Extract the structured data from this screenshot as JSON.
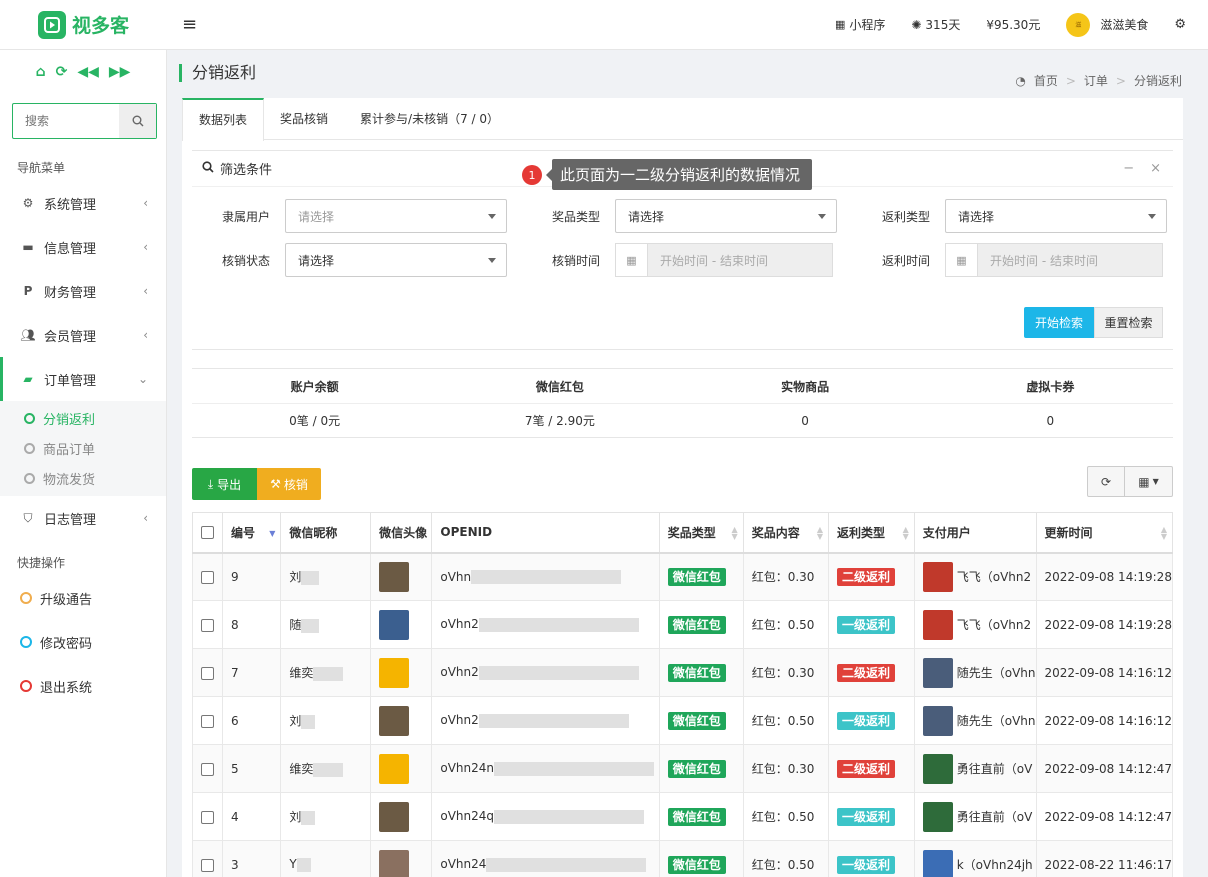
{
  "app": {
    "name": "视多客"
  },
  "top": {
    "miniprogram": "小程序",
    "days": "315天",
    "balance": "¥95.30元",
    "user": "滋滋美食",
    "avatar_text": "滋滋美食"
  },
  "sidebar": {
    "search_placeholder": "搜索",
    "nav_header": "导航菜单",
    "items": [
      {
        "label": "系统管理",
        "icon": "gear-icon"
      },
      {
        "label": "信息管理",
        "icon": "briefcase-icon"
      },
      {
        "label": "财务管理",
        "icon": "paypal-icon"
      },
      {
        "label": "会员管理",
        "icon": "users-icon"
      },
      {
        "label": "订单管理",
        "icon": "truck-icon"
      },
      {
        "label": "日志管理",
        "icon": "shield-icon"
      }
    ],
    "sub_items": [
      {
        "label": "分销返利"
      },
      {
        "label": "商品订单"
      },
      {
        "label": "物流发货"
      }
    ],
    "quick_header": "快捷操作",
    "quick": [
      {
        "label": "升级通告",
        "color": "#f0ad4e"
      },
      {
        "label": "修改密码",
        "color": "#1cb6e8"
      },
      {
        "label": "退出系统",
        "color": "#e53935"
      }
    ]
  },
  "page": {
    "title": "分销返利",
    "breadcrumb": [
      "首页",
      "订单",
      "分销返利"
    ],
    "tabs": [
      "数据列表",
      "奖品核销",
      "累计参与/未核销（7 / 0）"
    ]
  },
  "filter": {
    "title": "筛选条件",
    "tooltip": "此页面为一二级分销返利的数据情况",
    "tooltip_badge": "1",
    "fields": {
      "owner": {
        "label": "隶属用户",
        "value": "请选择"
      },
      "prize_type": {
        "label": "奖品类型",
        "value": "请选择"
      },
      "rebate_type": {
        "label": "返利类型",
        "value": "请选择"
      },
      "verify_status": {
        "label": "核销状态",
        "value": "请选择"
      },
      "verify_time": {
        "label": "核销时间",
        "placeholder": "开始时间 - 结束时间"
      },
      "rebate_time": {
        "label": "返利时间",
        "placeholder": "开始时间 - 结束时间"
      }
    },
    "search_btn": "开始检索",
    "reset_btn": "重置检索"
  },
  "stats": {
    "headers": [
      "账户余额",
      "微信红包",
      "实物商品",
      "虚拟卡券"
    ],
    "values": [
      "0笔 / 0元",
      "7笔 / 2.90元",
      "0",
      "0"
    ]
  },
  "toolbar": {
    "export": "导出",
    "verify": "核销"
  },
  "table": {
    "headers": [
      "编号",
      "微信昵称",
      "微信头像",
      "OPENID",
      "奖品类型",
      "奖品内容",
      "返利类型",
      "支付用户",
      "更新时间"
    ],
    "rows": [
      {
        "id": "9",
        "nick": "刘",
        "openid": "oVhn",
        "prize": "微信红包",
        "content": "红包：0.30",
        "rebate": "二级返利",
        "payer": "飞飞（oVhn2",
        "time": "2022-09-08 14:19:28"
      },
      {
        "id": "8",
        "nick": "随",
        "openid": "oVhn2",
        "prize": "微信红包",
        "content": "红包：0.50",
        "rebate": "一级返利",
        "payer": "飞飞（oVhn2",
        "time": "2022-09-08 14:19:28"
      },
      {
        "id": "7",
        "nick": "维奕",
        "openid": "oVhn2",
        "prize": "微信红包",
        "content": "红包：0.30",
        "rebate": "二级返利",
        "payer": "随先生（oVhn",
        "time": "2022-09-08 14:16:12"
      },
      {
        "id": "6",
        "nick": "刘",
        "openid": "oVhn2",
        "prize": "微信红包",
        "content": "红包：0.50",
        "rebate": "一级返利",
        "payer": "随先生（oVhn",
        "time": "2022-09-08 14:16:12"
      },
      {
        "id": "5",
        "nick": "维奕",
        "openid": "oVhn24n",
        "prize": "微信红包",
        "content": "红包：0.30",
        "rebate": "二级返利",
        "payer": "勇往直前（oV",
        "time": "2022-09-08 14:12:47"
      },
      {
        "id": "4",
        "nick": "刘",
        "openid": "oVhn24q",
        "prize": "微信红包",
        "content": "红包：0.50",
        "rebate": "一级返利",
        "payer": "勇往直前（oV",
        "time": "2022-09-08 14:12:47"
      },
      {
        "id": "3",
        "nick": "Y",
        "openid": "oVhn24",
        "prize": "微信红包",
        "content": "红包：0.50",
        "rebate": "一级返利",
        "payer": "k（oVhn24jh",
        "time": "2022-08-22 11:46:17"
      }
    ]
  },
  "colors": {
    "primary": "#28b463",
    "info": "#1cb6e8",
    "warning": "#f0ad1f",
    "danger": "#e53935",
    "teal": "#3cc4c8"
  }
}
